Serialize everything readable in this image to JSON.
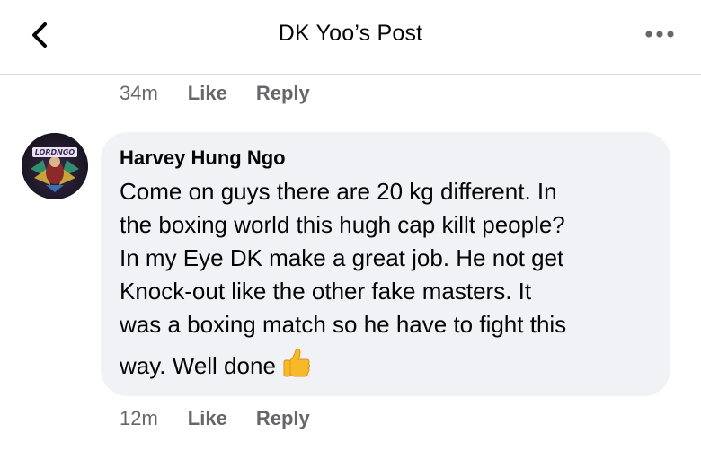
{
  "header": {
    "title": "DK Yoo’s Post"
  },
  "previous_comment_actions": {
    "time": "34m",
    "like_label": "Like",
    "reply_label": "Reply"
  },
  "comment": {
    "author": "Harvey Hung Ngo",
    "avatar_text": "LORDNGO",
    "lines": [
      "Come on guys there are 20 kg different. In",
      "the boxing world this hugh cap killt people?",
      "In my Eye DK make a great job. He not get",
      "Knock-out like the other fake masters. It",
      "was a boxing match so he have to fight this",
      "way. Well done"
    ],
    "emoji_icon": "thumbs-up-icon",
    "actions": {
      "time": "12m",
      "like_label": "Like",
      "reply_label": "Reply"
    }
  },
  "colors": {
    "bubble": "#f0f2f5",
    "meta_text": "#65676b",
    "divider": "#d9d9d9",
    "thumb": "#f7b928"
  }
}
